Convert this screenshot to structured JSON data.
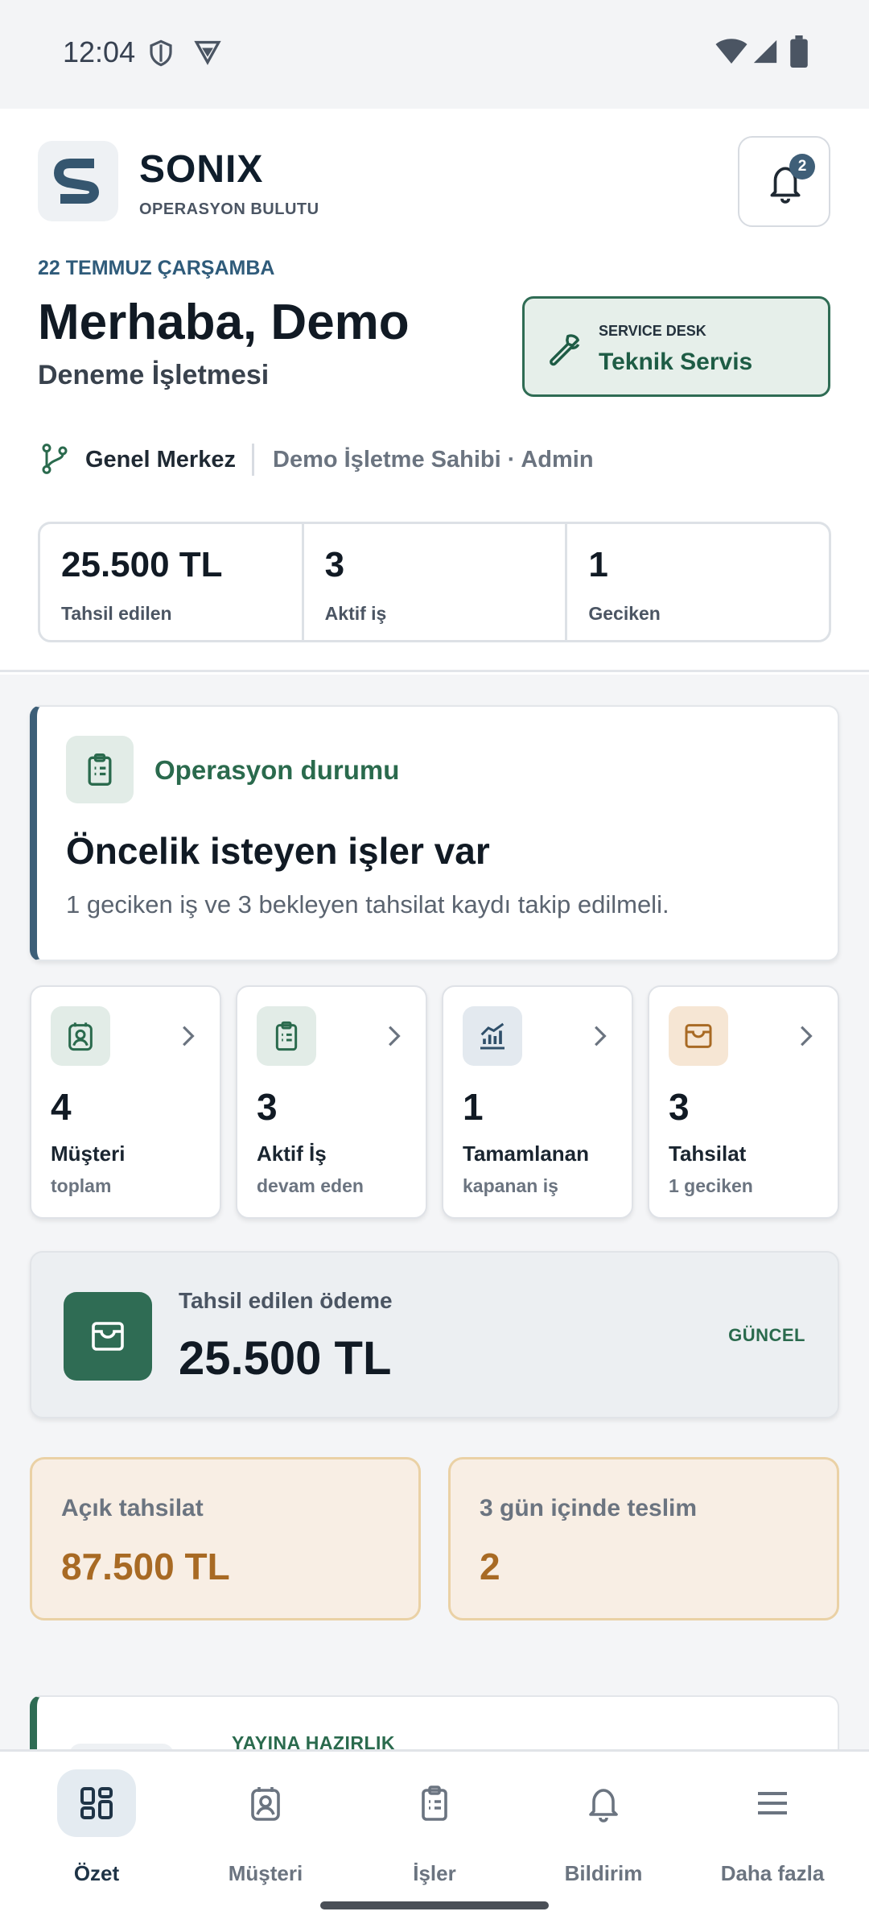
{
  "status": {
    "time": "12:04"
  },
  "brand": {
    "name": "SONIX",
    "subtitle": "OPERASYON BULUTU",
    "notif_count": "2"
  },
  "hero": {
    "date": "22 TEMMUZ ÇARŞAMBA",
    "greeting": "Merhaba, Demo",
    "business": "Deneme İşletmesi",
    "service_kicker": "SERVICE DESK",
    "service_title": "Teknik Servis",
    "branch": "Genel Merkez",
    "owner": "Demo İşletme Sahibi · Admin"
  },
  "stats": [
    {
      "value": "25.500 TL",
      "label": "Tahsil edilen"
    },
    {
      "value": "3",
      "label": "Aktif iş"
    },
    {
      "value": "1",
      "label": "Geciken"
    }
  ],
  "operation": {
    "label": "Operasyon durumu",
    "title": "Öncelik isteyen işler var",
    "desc": "1 geciken iş ve 3 bekleyen tahsilat kaydı takip edilmeli."
  },
  "kpis": [
    {
      "value": "4",
      "label": "Müşteri",
      "sub": "toplam",
      "icon": "customer-icon",
      "bg": "#e2ece7",
      "color": "#2a6a4d"
    },
    {
      "value": "3",
      "label": "Aktif İş",
      "sub": "devam eden",
      "icon": "clipboard-icon",
      "bg": "#e2ece7",
      "color": "#2a6a4d"
    },
    {
      "value": "1",
      "label": "Tamamlanan",
      "sub": "kapanan iş",
      "icon": "chart-icon",
      "bg": "#e3e9ef",
      "color": "#2f4f6a"
    },
    {
      "value": "3",
      "label": "Tahsilat",
      "sub": "1 geciken",
      "icon": "wallet-icon",
      "bg": "#f6e6d4",
      "color": "#a86a24"
    }
  ],
  "payment": {
    "label": "Tahsil edilen ödeme",
    "value": "25.500 TL",
    "tag": "GÜNCEL"
  },
  "mini": [
    {
      "label": "Açık tahsilat",
      "value": "87.500 TL"
    },
    {
      "label": "3 gün içinde teslim",
      "value": "2"
    }
  ],
  "ready": {
    "label": "YAYINA HAZIRLIK"
  },
  "nav": [
    {
      "label": "Özet",
      "icon": "dashboard-icon",
      "active": true
    },
    {
      "label": "Müşteri",
      "icon": "customer-icon",
      "active": false
    },
    {
      "label": "İşler",
      "icon": "clipboard-icon",
      "active": false
    },
    {
      "label": "Bildirim",
      "icon": "bell-icon",
      "active": false
    },
    {
      "label": "Daha fazla",
      "icon": "menu-icon",
      "active": false
    }
  ],
  "colors": {
    "primary": "#2f6c54",
    "navy": "#3d5f78",
    "accent": "#a86a24"
  }
}
